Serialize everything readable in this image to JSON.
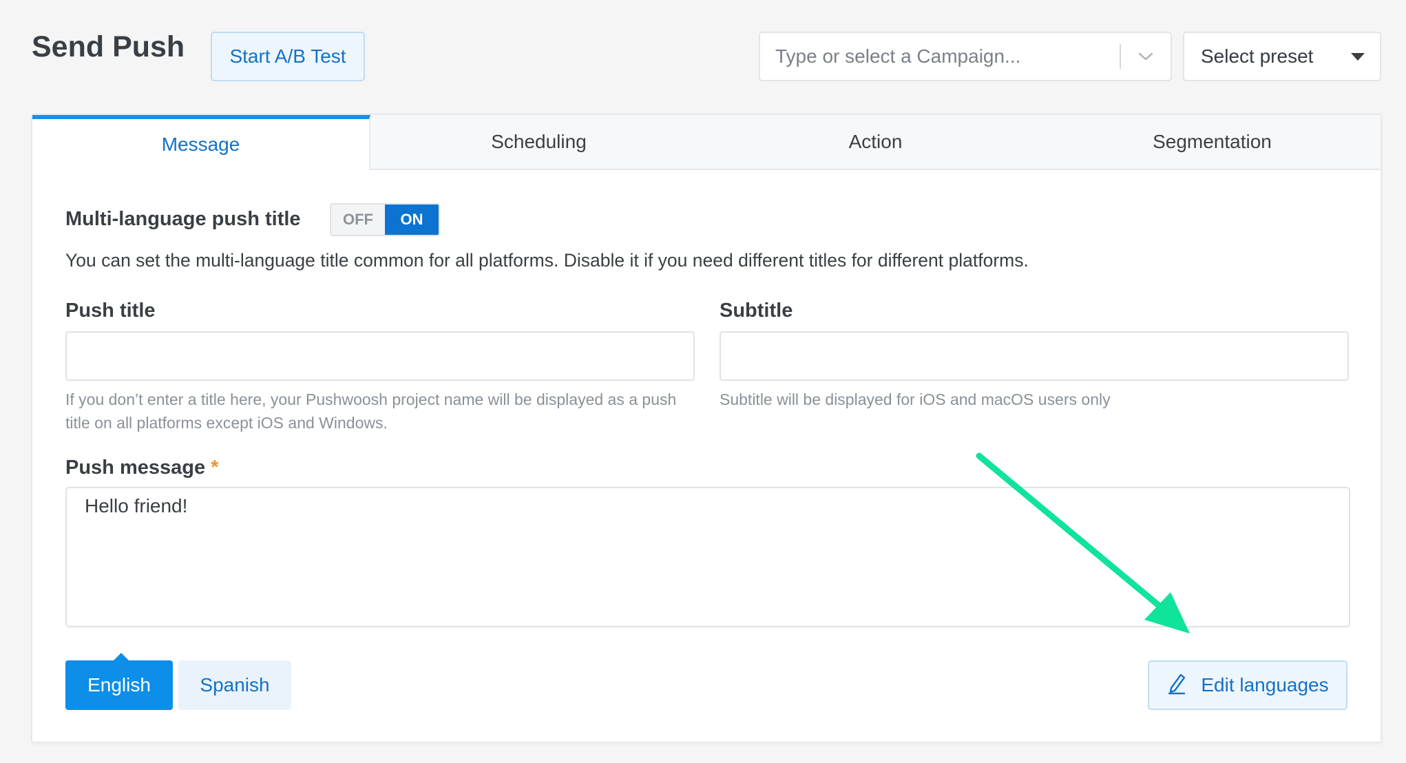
{
  "header": {
    "title": "Send Push",
    "ab_test_label": "Start A/B Test",
    "campaign_placeholder": "Type or select a Campaign...",
    "preset_label": "Select preset"
  },
  "tabs": [
    {
      "label": "Message",
      "active": true
    },
    {
      "label": "Scheduling",
      "active": false
    },
    {
      "label": "Action",
      "active": false
    },
    {
      "label": "Segmentation",
      "active": false
    }
  ],
  "message": {
    "multilang_label": "Multi-language push title",
    "toggle_off": "OFF",
    "toggle_on": "ON",
    "toggle_state": "ON",
    "multilang_desc": "You can set the multi-language title common for all platforms. Disable it if you need different titles for different platforms.",
    "push_title_label": "Push title",
    "push_title_value": "",
    "push_title_hint": "If you don’t enter a title here, your Pushwoosh project name will be displayed as a push title on all platforms except iOS and Windows.",
    "subtitle_label": "Subtitle",
    "subtitle_value": "",
    "subtitle_hint": "Subtitle will be displayed for iOS and macOS users only",
    "push_message_label": "Push message",
    "required_mark": "*",
    "push_message_value": "Hello friend!",
    "languages": [
      "English",
      "Spanish"
    ],
    "selected_language": "English",
    "edit_languages_label": "Edit languages"
  },
  "colors": {
    "accent": "#1471c8",
    "active_tab_border": "#1a8fe6",
    "annotation_arrow": "#10e39a",
    "required": "#f0962a"
  }
}
